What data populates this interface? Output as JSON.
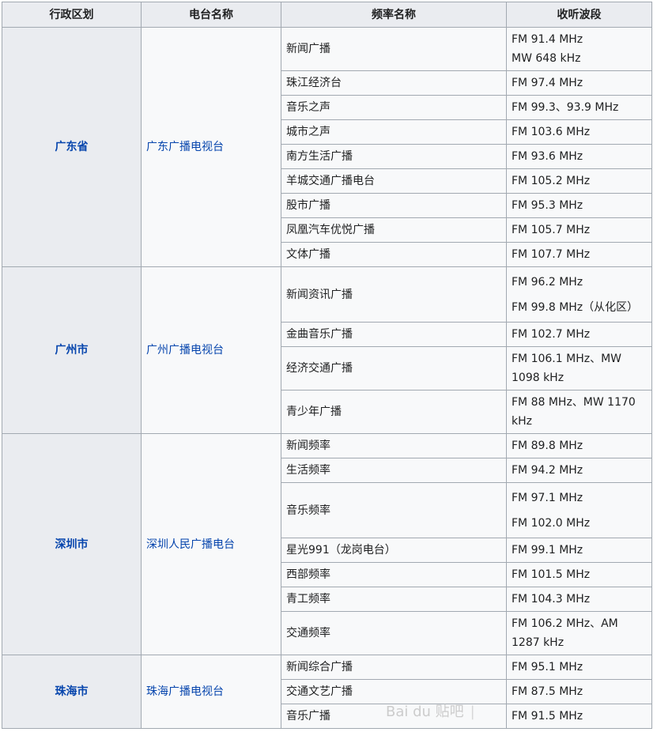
{
  "headers": [
    "行政区划",
    "电台名称",
    "频率名称",
    "收听波段"
  ],
  "groups": [
    {
      "region": "广东省",
      "station": "广东广播电视台",
      "rows": [
        {
          "channel": "新闻广播",
          "band": [
            "FM 91.4 MHz",
            "MW 648 kHz"
          ],
          "h": 55
        },
        {
          "channel": "珠江经济台",
          "band": [
            "FM 97.4 MHz"
          ],
          "h": 31
        },
        {
          "channel": "音乐之声",
          "band": [
            "FM 99.3、93.9 MHz"
          ],
          "h": 31
        },
        {
          "channel": "城市之声",
          "band": [
            "FM 103.6 MHz"
          ],
          "h": 31
        },
        {
          "channel": "南方生活广播",
          "band": [
            "FM 93.6 MHz"
          ],
          "h": 31
        },
        {
          "channel": "羊城交通广播电台",
          "band": [
            "FM 105.2 MHz"
          ],
          "h": 31
        },
        {
          "channel": "股市广播",
          "band": [
            "FM 95.3 MHz"
          ],
          "h": 31
        },
        {
          "channel": "凤凰汽车优悦广播",
          "band": [
            "FM 105.7 MHz"
          ],
          "h": 31
        },
        {
          "channel": "文体广播",
          "band": [
            "FM 107.7 MHz"
          ],
          "h": 31
        }
      ]
    },
    {
      "region": "广州市",
      "station": "广州广播电视台",
      "rows": [
        {
          "channel": "新闻资讯广播",
          "band": [
            "FM 96.2 MHz",
            "FM 99.8 MHz（从化区）"
          ],
          "gap": true,
          "h": 70
        },
        {
          "channel": "金曲音乐广播",
          "band": [
            "FM 102.7 MHz"
          ],
          "h": 31
        },
        {
          "channel": "经济交通广播",
          "band": [
            "FM 106.1 MHz、MW 1098 kHz"
          ],
          "h": 55
        },
        {
          "channel": "青少年广播",
          "band": [
            "FM 88 MHz、MW 1170 kHz"
          ],
          "h": 55
        }
      ]
    },
    {
      "region": "深圳市",
      "station": "深圳人民广播电台",
      "rows": [
        {
          "channel": "新闻频率",
          "band": [
            "FM 89.8 MHz"
          ],
          "h": 31
        },
        {
          "channel": "生活频率",
          "band": [
            "FM 94.2 MHz"
          ],
          "h": 31
        },
        {
          "channel": "音乐频率",
          "band": [
            "FM 97.1 MHz",
            "FM 102.0 MHz"
          ],
          "gap": true,
          "h": 70
        },
        {
          "channel": "星光991（龙岗电台）",
          "band": [
            "FM 99.1 MHz"
          ],
          "h": 31
        },
        {
          "channel": "西部频率",
          "band": [
            "FM 101.5 MHz"
          ],
          "h": 31
        },
        {
          "channel": "青工频率",
          "band": [
            "FM 104.3 MHz"
          ],
          "h": 31
        },
        {
          "channel": "交通频率",
          "band": [
            "FM 106.2 MHz、AM 1287 kHz"
          ],
          "h": 55
        }
      ]
    },
    {
      "region": "珠海市",
      "station": "珠海广播电视台",
      "rows": [
        {
          "channel": "新闻综合广播",
          "band": [
            "FM 95.1 MHz"
          ],
          "h": 31
        },
        {
          "channel": "交通文艺广播",
          "band": [
            "FM 87.5 MHz"
          ],
          "h": 31
        },
        {
          "channel": "音乐广播",
          "band": [
            "FM 91.5 MHz"
          ],
          "h": 31
        }
      ]
    }
  ],
  "watermark": {
    "brand": "Bai du 贴吧",
    "text": "|"
  }
}
